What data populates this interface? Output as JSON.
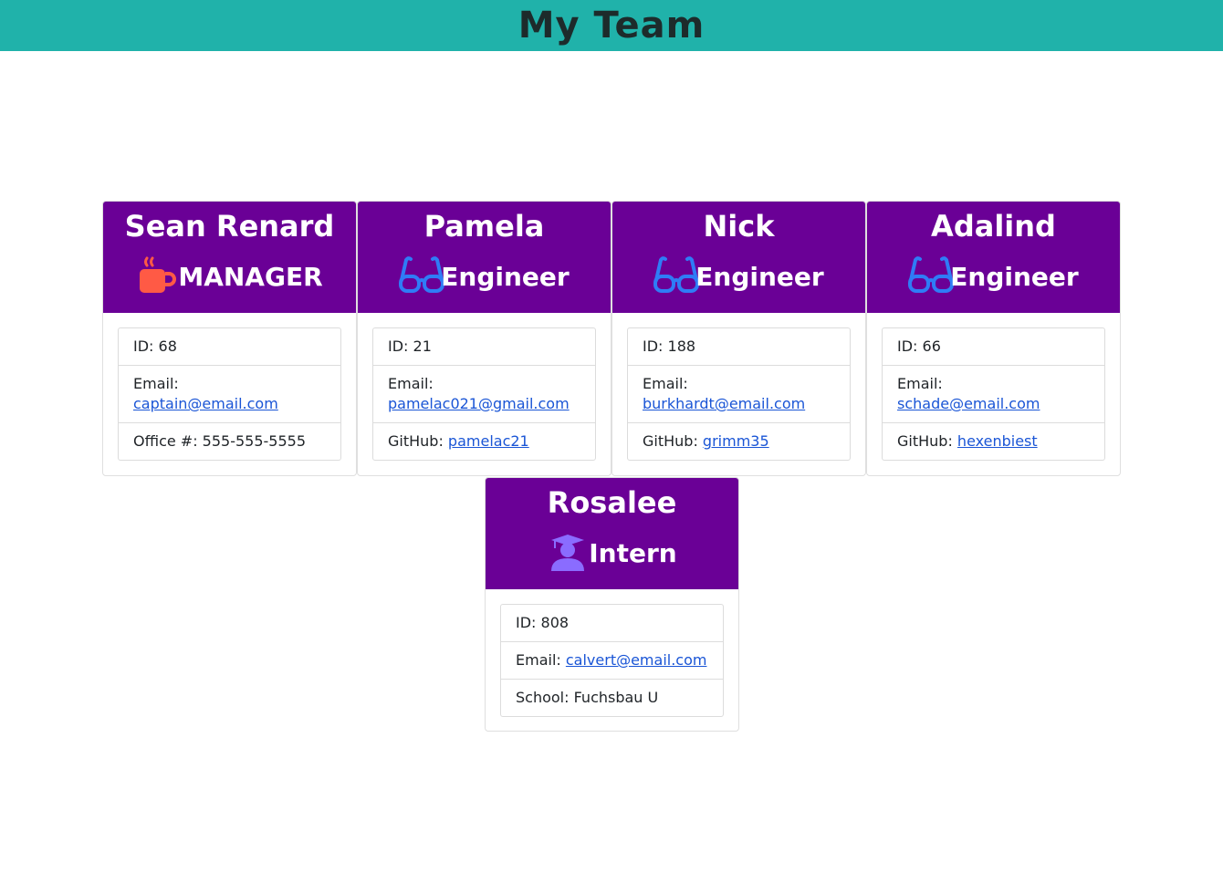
{
  "header": {
    "title": "My Team"
  },
  "team": [
    {
      "name": "Sean Renard",
      "role": "MANAGER",
      "icon": "coffee-icon",
      "id_label": "ID: ",
      "id": "68",
      "email_label": "Email: ",
      "email": "captain@email.com",
      "extra_label": "Office #: ",
      "extra": "555-555-5555"
    },
    {
      "name": "Pamela",
      "role": "Engineer",
      "icon": "glasses-icon",
      "id_label": "ID: ",
      "id": "21",
      "email_label": "Email: ",
      "email": "pamelac021@gmail.com",
      "extra_label": "GitHub: ",
      "extra": "pamelac21"
    },
    {
      "name": "Nick",
      "role": "Engineer",
      "icon": "glasses-icon",
      "id_label": "ID: ",
      "id": "188",
      "email_label": "Email: ",
      "email": "burkhardt@email.com",
      "extra_label": "GitHub: ",
      "extra": "grimm35"
    },
    {
      "name": "Adalind",
      "role": "Engineer",
      "icon": "glasses-icon",
      "id_label": "ID: ",
      "id": "66",
      "email_label": "Email: ",
      "email": "schade@email.com",
      "extra_label": "GitHub: ",
      "extra": "hexenbiest"
    },
    {
      "name": "Rosalee",
      "role": "Intern",
      "icon": "graduate-icon",
      "id_label": "ID: ",
      "id": "808",
      "email_label": "Email: ",
      "email": "calvert@email.com",
      "extra_label": "School: ",
      "extra": "Fuchsbau U"
    }
  ],
  "colors": {
    "header_bg": "#20b2aa",
    "card_head_bg": "#6a0096",
    "coffee": "#ff5a45",
    "glasses": "#2f7cf6",
    "graduate": "#8a6cff",
    "link": "#1a55d6"
  }
}
